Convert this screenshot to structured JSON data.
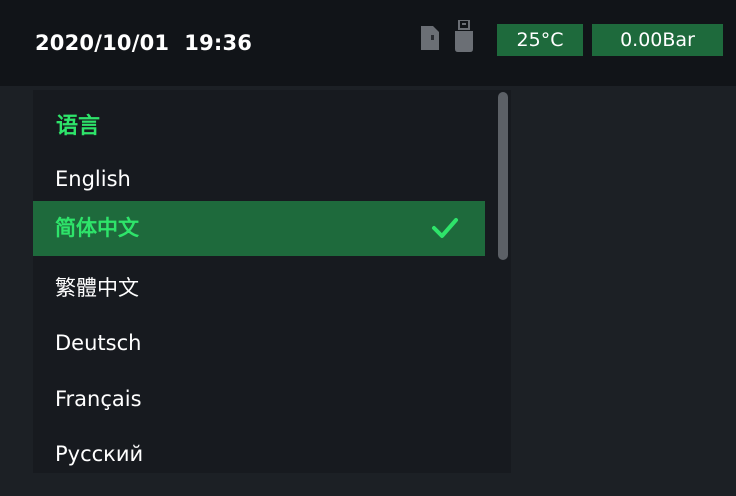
{
  "status": {
    "datetime": "2020/10/01  19:36",
    "temperature": "25°C",
    "pressure": "0.00Bar",
    "icons": [
      "sd-card-icon",
      "usb-drive-icon"
    ],
    "accent_color": "#1e6a3c"
  },
  "language_menu": {
    "title": "语言",
    "items": [
      {
        "label": "English",
        "selected": false
      },
      {
        "label": "简体中文",
        "selected": true
      },
      {
        "label": "繁體中文",
        "selected": false
      },
      {
        "label": "Deutsch",
        "selected": false
      },
      {
        "label": "Français",
        "selected": false
      },
      {
        "label": "Русский",
        "selected": false
      }
    ],
    "selected_icon": "check-icon",
    "highlight_color": "#2ee46a"
  }
}
